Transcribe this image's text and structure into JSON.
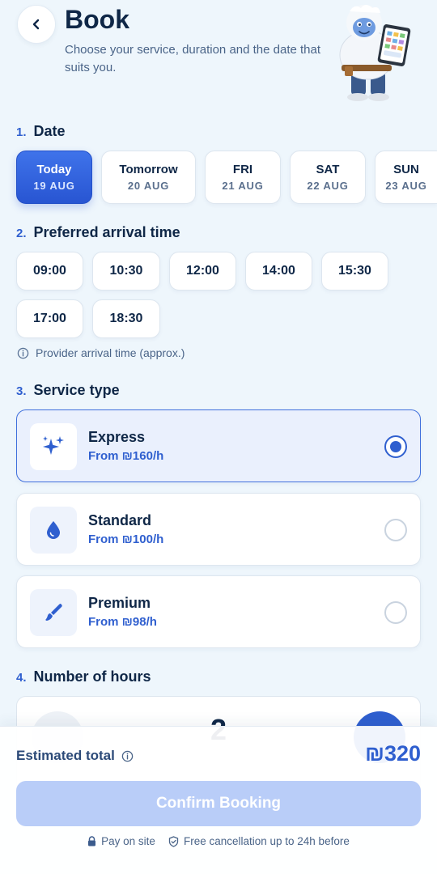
{
  "header": {
    "back_icon": "chevron-left-icon",
    "title": "Book",
    "subtitle": "Choose your service, duration and the date that suits you."
  },
  "sections": {
    "date": {
      "number": "1.",
      "title": "Date"
    },
    "arrival": {
      "number": "2.",
      "title": "Preferred arrival time"
    },
    "service": {
      "number": "3.",
      "title": "Service type"
    },
    "hours": {
      "number": "4.",
      "title": "Number of hours"
    }
  },
  "dates": [
    {
      "label": "Today",
      "date": "19 AUG",
      "selected": true
    },
    {
      "label": "Tomorrow",
      "date": "20 AUG",
      "selected": false
    },
    {
      "label": "FRI",
      "date": "21 AUG",
      "selected": false
    },
    {
      "label": "SAT",
      "date": "22 AUG",
      "selected": false
    },
    {
      "label": "SUN",
      "date": "23 AUG",
      "selected": false
    }
  ],
  "times": [
    "09:00",
    "10:30",
    "12:00",
    "14:00",
    "15:30",
    "17:00",
    "18:30"
  ],
  "arrival_note": "Provider arrival time (approx.)",
  "services": [
    {
      "name": "Express",
      "price": "From ₪160/h",
      "icon": "sparkles-icon",
      "selected": true
    },
    {
      "name": "Standard",
      "price": "From ₪100/h",
      "icon": "droplet-icon",
      "selected": false
    },
    {
      "name": "Premium",
      "price": "From ₪98/h",
      "icon": "brush-icon",
      "selected": false
    }
  ],
  "hours_value": "2",
  "summary": {
    "total_label": "Estimated total",
    "total_value": "₪320",
    "confirm_label": "Confirm Booking",
    "pay_note": "Pay on site",
    "cancel_note": "Free cancellation up to 24h before"
  },
  "colors": {
    "accent": "#2f5fcf",
    "background": "#eef6fc",
    "confirm_disabled": "#b9cdf8"
  }
}
